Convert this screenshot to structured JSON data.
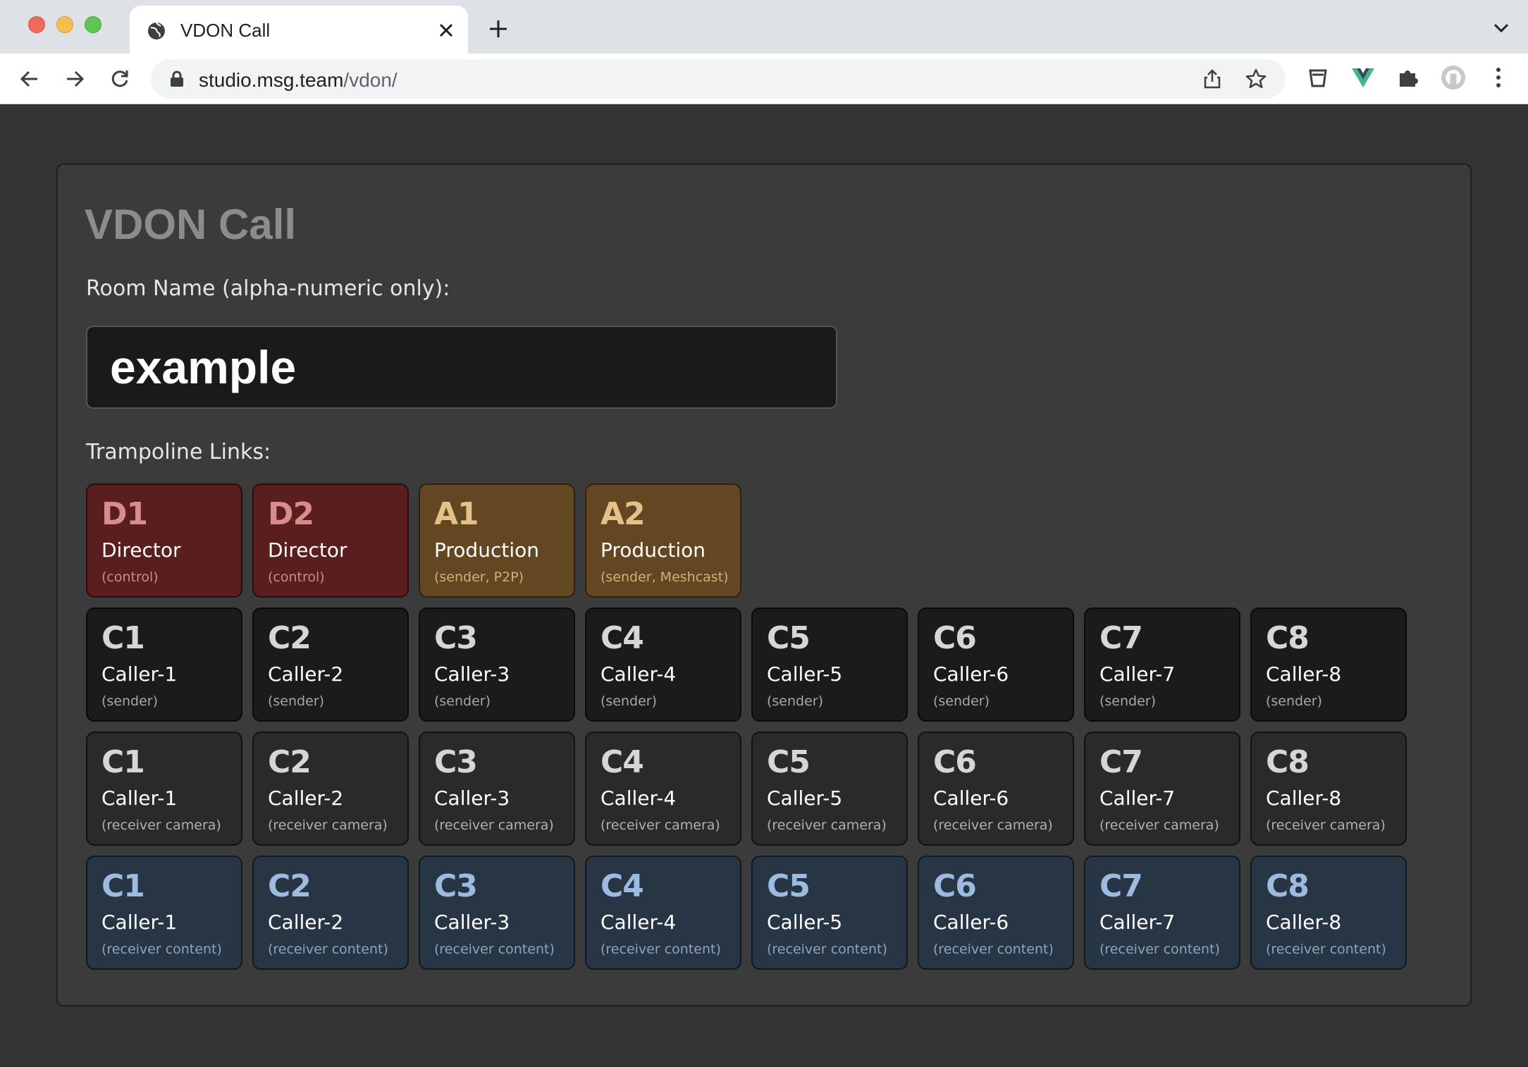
{
  "browser": {
    "tab_title": "VDON Call",
    "url_host": "studio.msg.team",
    "url_path": "/vdon/"
  },
  "page": {
    "title": "VDON Call",
    "room_label": "Room Name (alpha-numeric only):",
    "room_value": "example",
    "trampoline_label": "Trampoline Links:"
  },
  "links": {
    "top_row": [
      {
        "code": "D1",
        "name": "Director",
        "sub": "(control)",
        "kind": "director"
      },
      {
        "code": "D2",
        "name": "Director",
        "sub": "(control)",
        "kind": "director"
      },
      {
        "code": "A1",
        "name": "Production",
        "sub": "(sender, P2P)",
        "kind": "production"
      },
      {
        "code": "A2",
        "name": "Production",
        "sub": "(sender, Meshcast)",
        "kind": "production"
      }
    ],
    "sender_row": [
      {
        "code": "C1",
        "name": "Caller-1",
        "sub": "(sender)"
      },
      {
        "code": "C2",
        "name": "Caller-2",
        "sub": "(sender)"
      },
      {
        "code": "C3",
        "name": "Caller-3",
        "sub": "(sender)"
      },
      {
        "code": "C4",
        "name": "Caller-4",
        "sub": "(sender)"
      },
      {
        "code": "C5",
        "name": "Caller-5",
        "sub": "(sender)"
      },
      {
        "code": "C6",
        "name": "Caller-6",
        "sub": "(sender)"
      },
      {
        "code": "C7",
        "name": "Caller-7",
        "sub": "(sender)"
      },
      {
        "code": "C8",
        "name": "Caller-8",
        "sub": "(sender)"
      }
    ],
    "camera_row": [
      {
        "code": "C1",
        "name": "Caller-1",
        "sub": "(receiver camera)"
      },
      {
        "code": "C2",
        "name": "Caller-2",
        "sub": "(receiver camera)"
      },
      {
        "code": "C3",
        "name": "Caller-3",
        "sub": "(receiver camera)"
      },
      {
        "code": "C4",
        "name": "Caller-4",
        "sub": "(receiver camera)"
      },
      {
        "code": "C5",
        "name": "Caller-5",
        "sub": "(receiver camera)"
      },
      {
        "code": "C6",
        "name": "Caller-6",
        "sub": "(receiver camera)"
      },
      {
        "code": "C7",
        "name": "Caller-7",
        "sub": "(receiver camera)"
      },
      {
        "code": "C8",
        "name": "Caller-8",
        "sub": "(receiver camera)"
      }
    ],
    "content_row": [
      {
        "code": "C1",
        "name": "Caller-1",
        "sub": "(receiver content)"
      },
      {
        "code": "C2",
        "name": "Caller-2",
        "sub": "(receiver content)"
      },
      {
        "code": "C3",
        "name": "Caller-3",
        "sub": "(receiver content)"
      },
      {
        "code": "C4",
        "name": "Caller-4",
        "sub": "(receiver content)"
      },
      {
        "code": "C5",
        "name": "Caller-5",
        "sub": "(receiver content)"
      },
      {
        "code": "C6",
        "name": "Caller-6",
        "sub": "(receiver content)"
      },
      {
        "code": "C7",
        "name": "Caller-7",
        "sub": "(receiver content)"
      },
      {
        "code": "C8",
        "name": "Caller-8",
        "sub": "(receiver content)"
      }
    ]
  },
  "icons": {
    "tab": "globe-icon",
    "close": "close-icon",
    "new_tab": "plus-icon",
    "nav": [
      "back-arrow-icon",
      "forward-arrow-icon",
      "reload-icon"
    ],
    "omnibox": [
      "lock-icon",
      "share-icon",
      "star-icon"
    ],
    "extensions": [
      "shield-extension-icon",
      "vue-extension-icon",
      "puzzle-extension-icon",
      "profile-avatar-icon",
      "more-menu-icon"
    ]
  },
  "colors": {
    "director": "#5b1e1e",
    "production": "#634622",
    "sender": "#1b1b1b",
    "receiver_camera": "#2a2a2a",
    "receiver_content": "#283544"
  }
}
